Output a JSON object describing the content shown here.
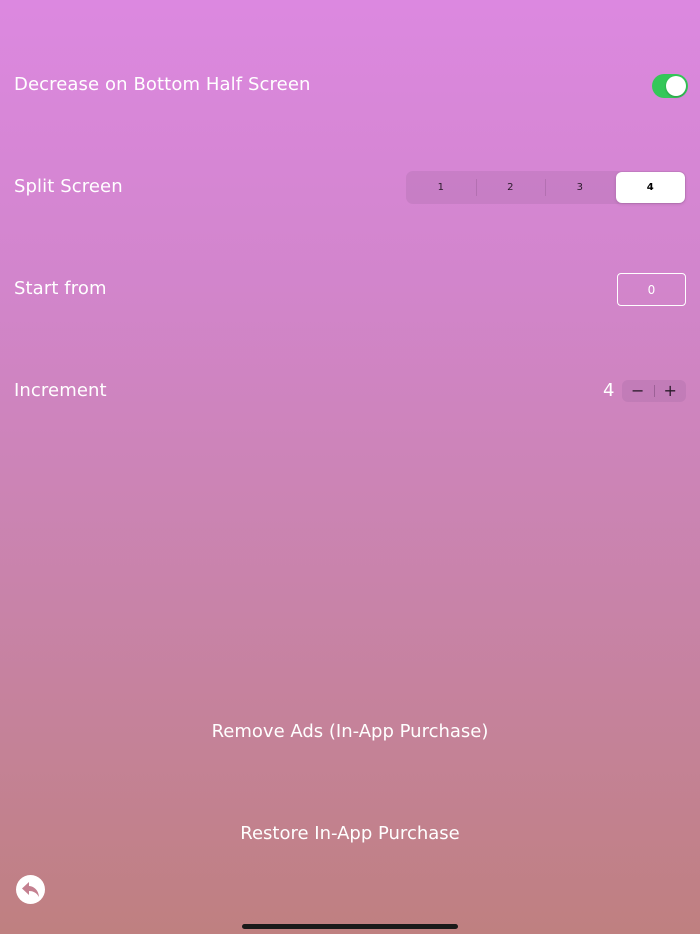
{
  "settings": {
    "decrease_bottom_half": {
      "label": "Decrease on Bottom Half Screen",
      "enabled": true,
      "toggle_color": "#34c759"
    },
    "split_screen": {
      "label": "Split Screen",
      "options": [
        "1",
        "2",
        "3",
        "4"
      ],
      "selected": "4"
    },
    "start_from": {
      "label": "Start from",
      "value": "0"
    },
    "increment": {
      "label": "Increment",
      "value": "4",
      "decrement_symbol": "−",
      "increment_symbol": "+"
    }
  },
  "actions": {
    "remove_ads": "Remove Ads (In-App Purchase)",
    "restore": "Restore In-App Purchase"
  },
  "icons": {
    "back": "back-arrow-icon"
  }
}
